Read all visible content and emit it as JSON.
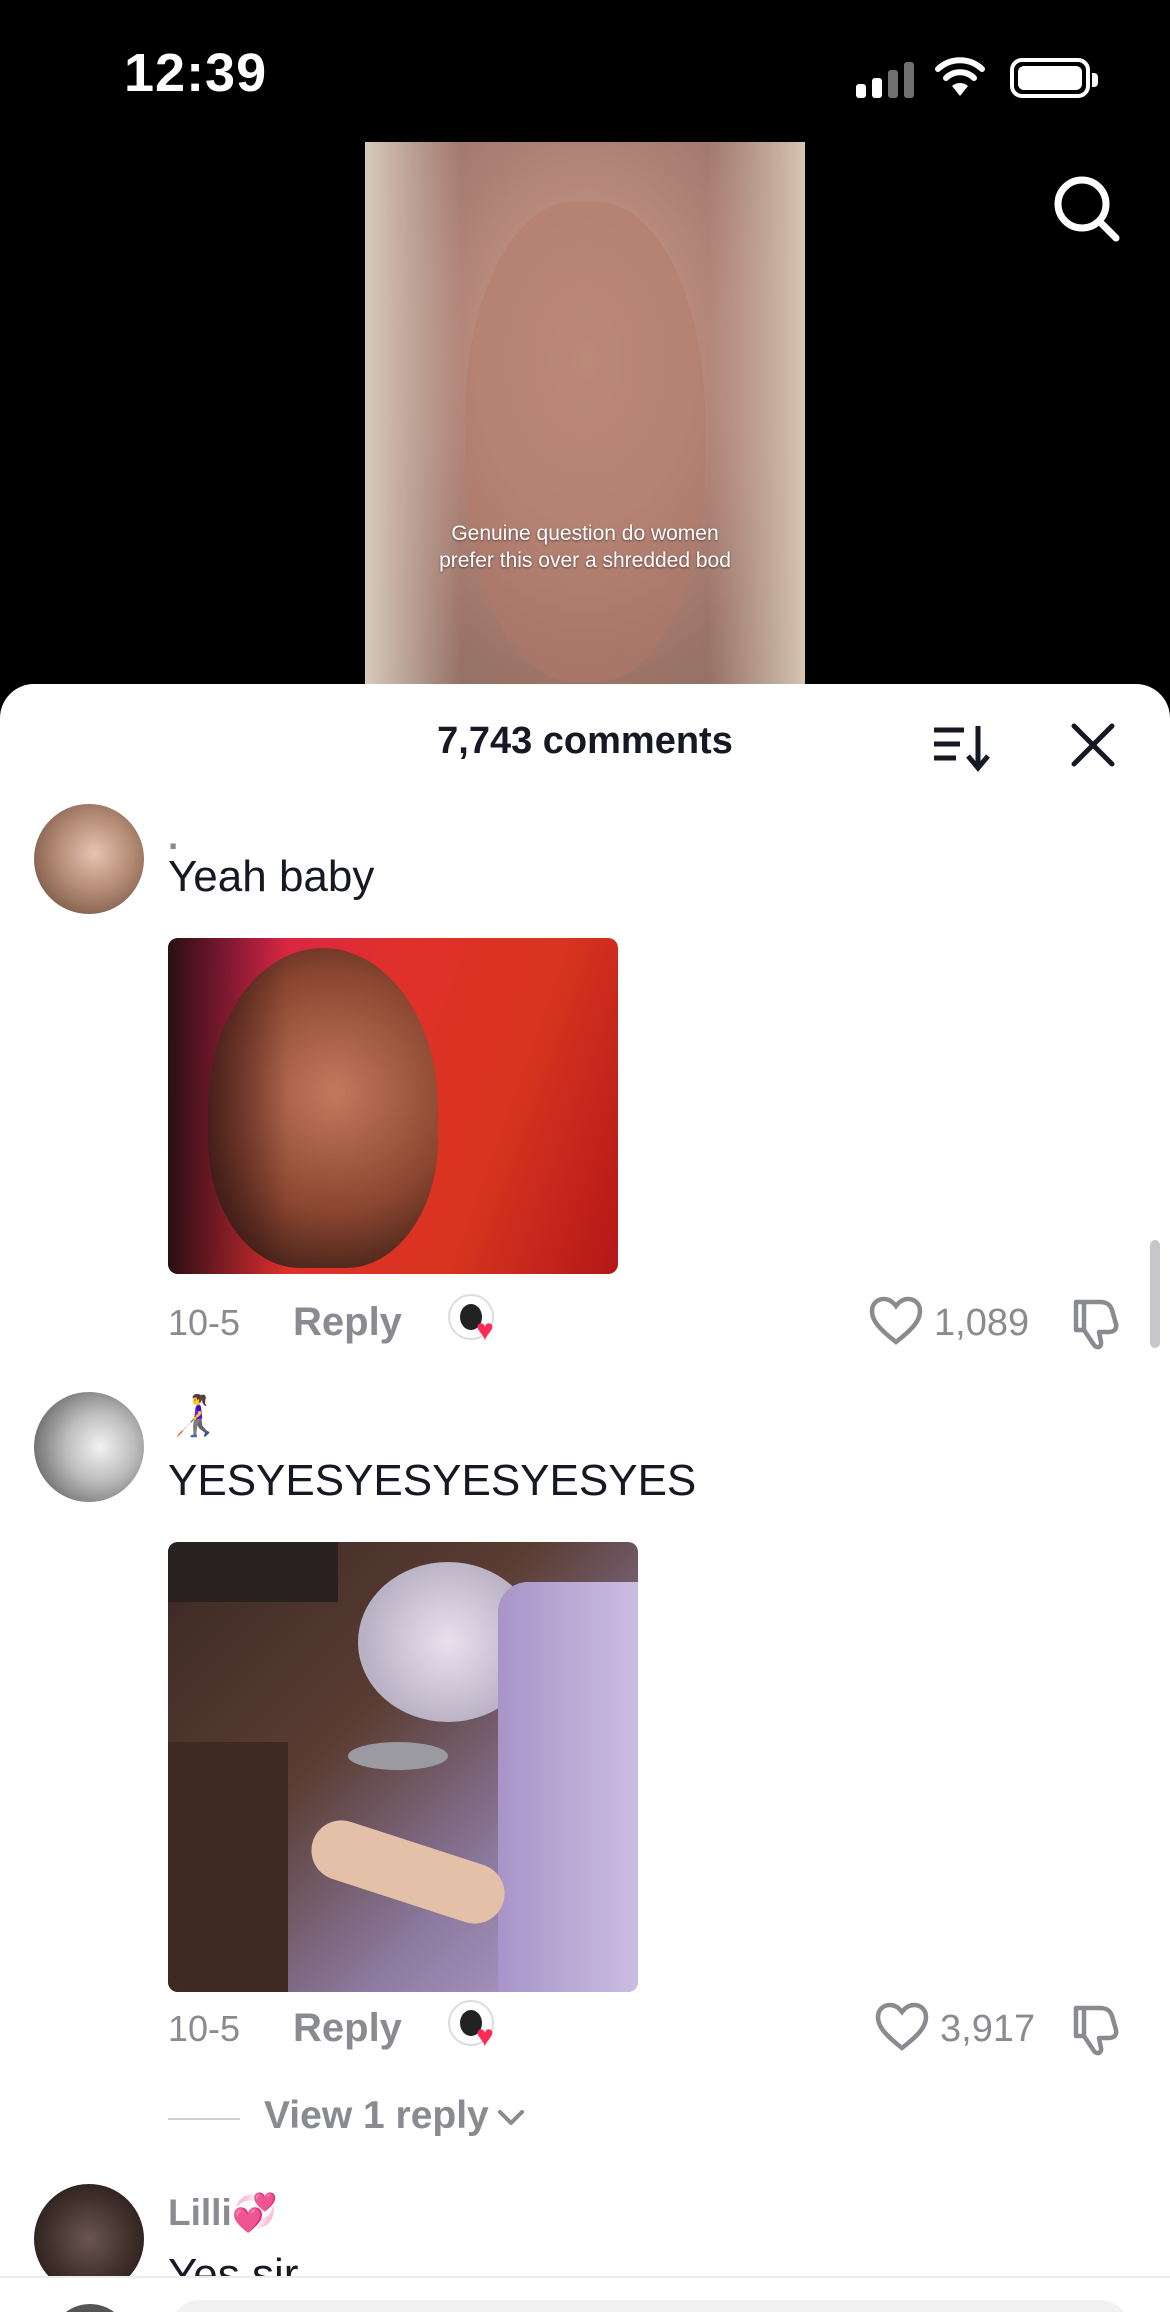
{
  "status_bar": {
    "time": "12:39",
    "battery_level": 1.0,
    "signal_bars": 2
  },
  "video": {
    "caption": "Genuine question do women prefer this over a shredded bod",
    "search_icon": "search-icon"
  },
  "sheet": {
    "comment_count": "7,743 comments",
    "sort_icon": "sort-icon",
    "close_icon": "close-icon"
  },
  "comments": [
    {
      "username": ".",
      "text": "Yeah baby",
      "date": "10-5",
      "reply_label": "Reply",
      "likes": "1,089",
      "creator_liked": true
    },
    {
      "username": "👩‍🦯",
      "text": "YESYESYESYESYESYES",
      "date": "10-5",
      "reply_label": "Reply",
      "likes": "3,917",
      "creator_liked": true,
      "view_replies": "View 1 reply"
    },
    {
      "username": "Lilli💞",
      "text": "Yes sir"
    }
  ],
  "colors": {
    "like_heart": "#fe2c55",
    "meta_gray": "#8a8b91",
    "text_dark": "#161823"
  }
}
